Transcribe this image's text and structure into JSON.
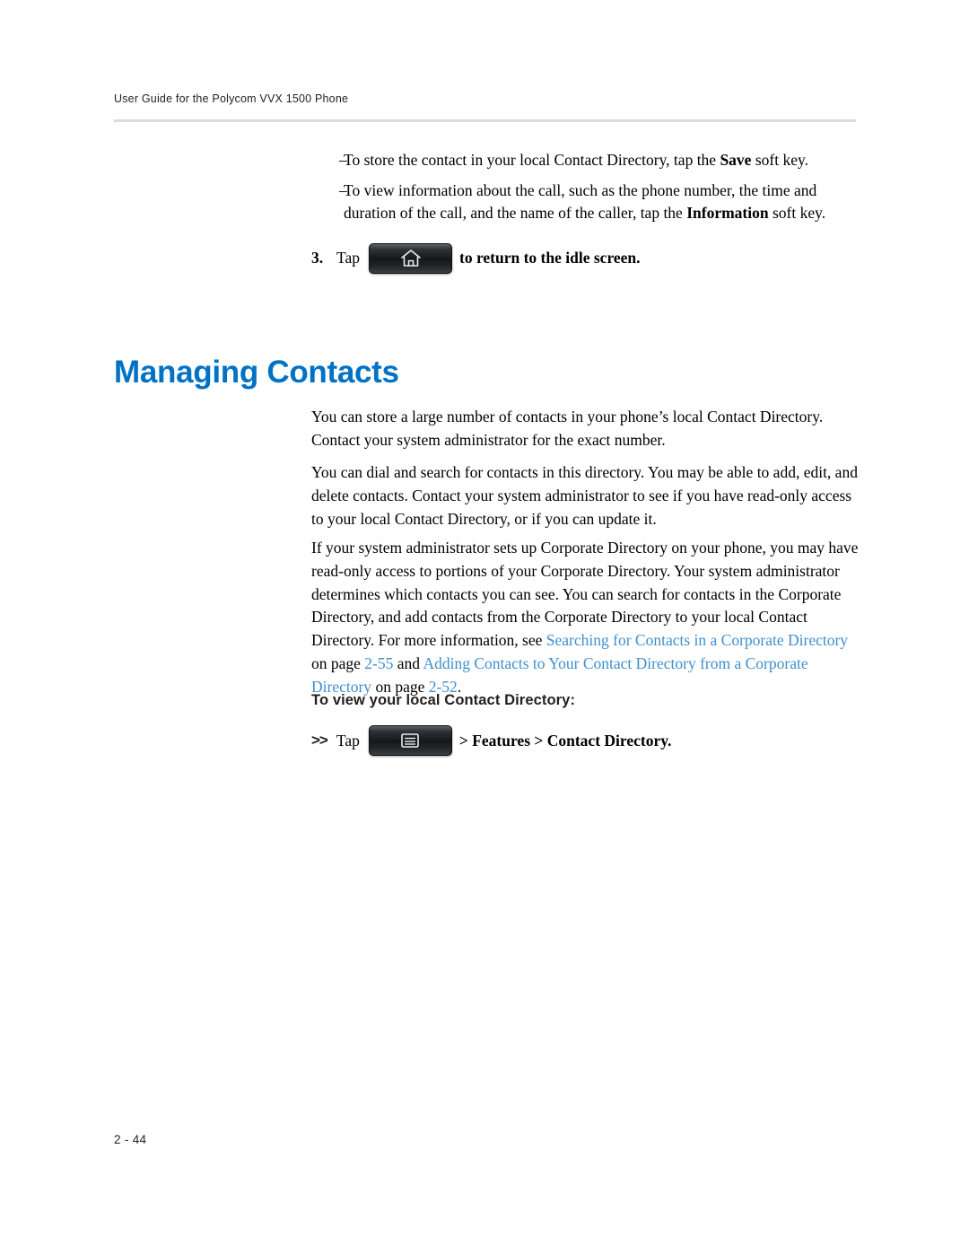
{
  "header": {
    "running_title": "User Guide for the Polycom VVX 1500 Phone"
  },
  "bullets": [
    {
      "dash": "–",
      "parts": [
        {
          "text": "To store the contact in your local Contact Directory, tap the ",
          "style": "normal"
        },
        {
          "text": "Save",
          "style": "bold"
        },
        {
          "text": " soft key.",
          "style": "normal"
        }
      ]
    },
    {
      "dash": "–",
      "parts": [
        {
          "text": "To view information about the call, such as the phone number, the time and duration of the call, and the name of the caller, tap the ",
          "style": "normal"
        },
        {
          "text": "Information",
          "style": "bold"
        },
        {
          "text": " soft key.",
          "style": "normal"
        }
      ]
    }
  ],
  "step": {
    "number": "3.",
    "verb": "Tap",
    "icon": "home-key-icon",
    "tail": "to return to the idle screen."
  },
  "heading": "Managing Contacts",
  "paragraphs": {
    "p1": "You can store a large number of contacts in your phone’s local Contact Directory. Contact your system administrator for the exact number.",
    "p2": "You can dial and search for contacts in this directory. You may be able to add, edit, and delete contacts. Contact your system administrator to see if you have read-only access to your local Contact Directory, or if you can update it.",
    "p3_a": "If your system administrator sets up Corporate Directory on your phone, you may have read-only access to portions of your Corporate Directory. Your system administrator determines which contacts you can see. You can search for contacts in the Corporate Directory, and add contacts from the Corporate Directory to your local Contact Directory. For more information, see ",
    "p3_link1": "Searching for Contacts in a Corporate Directory",
    "p3_mid1": " on page ",
    "p3_page1": "2-55",
    "p3_mid2": " and ",
    "p3_link2": "Adding Contacts to Your Contact Directory from a Corporate Directory",
    "p3_mid3": " on page ",
    "p3_page2": "2-52",
    "p3_end": "."
  },
  "subhead": "To view your local Contact Directory:",
  "action": {
    "arrows": ">>",
    "verb": "Tap",
    "icon": "menu-key-icon",
    "tail": "> Features > Contact Directory."
  },
  "footer": {
    "page_number": "2 - 44"
  },
  "colors": {
    "heading": "#0072C6",
    "link": "#3F8FCF",
    "rule": "#D9DBDD",
    "text": "#000000"
  }
}
